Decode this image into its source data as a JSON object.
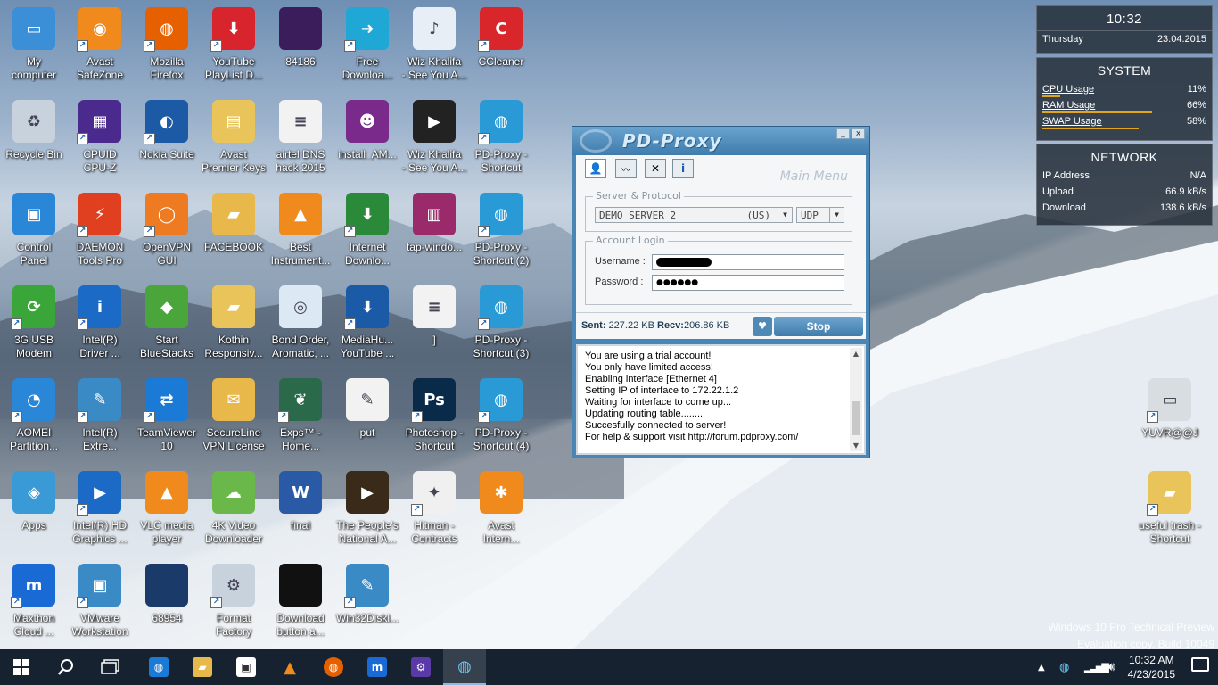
{
  "desktop": {
    "icons": [
      {
        "label": "My\ncomputer",
        "icon": "monitor-icon",
        "color": "#3a8fd6",
        "glyph": "▭",
        "shortcut": false
      },
      {
        "label": "Avast\nSafeZone",
        "icon": "avast-safezone-icon",
        "color": "#f08a1c",
        "glyph": "◉",
        "shortcut": true
      },
      {
        "label": "Mozilla\nFirefox",
        "icon": "firefox-icon",
        "color": "#e66000",
        "glyph": "◍",
        "shortcut": true
      },
      {
        "label": "YouTube\nPlayList D...",
        "icon": "youtube-downloader-icon",
        "color": "#d8242c",
        "glyph": "⬇",
        "shortcut": true
      },
      {
        "label": "84186",
        "icon": "image-thumbnail-icon",
        "color": "#3a1d5a",
        "glyph": "",
        "shortcut": false
      },
      {
        "label": "Free\nDownloa...",
        "icon": "free-download-icon",
        "color": "#1fa7d6",
        "glyph": "➜",
        "shortcut": true
      },
      {
        "label": "Wiz Khalifa\n- See You A...",
        "icon": "m4a-file-icon",
        "color": "#e8eef5",
        "glyph": "♪",
        "shortcut": false
      },
      {
        "label": "CCleaner",
        "icon": "ccleaner-icon",
        "color": "#d9262b",
        "glyph": "C",
        "shortcut": true
      },
      {
        "label": "Recycle Bin",
        "icon": "recycle-bin-icon",
        "color": "#c8d2dc",
        "glyph": "♻",
        "shortcut": false
      },
      {
        "label": "CPUID\nCPU-Z",
        "icon": "cpuz-icon",
        "color": "#4a2a8c",
        "glyph": "▦",
        "shortcut": true
      },
      {
        "label": "Nokia Suite",
        "icon": "nokia-suite-icon",
        "color": "#1c5aa6",
        "glyph": "◐",
        "shortcut": true
      },
      {
        "label": "Avast\nPremier Keys",
        "icon": "folder-docs-icon",
        "color": "#e8c45a",
        "glyph": "▤",
        "shortcut": false
      },
      {
        "label": "airtel DNS\nhack 2015",
        "icon": "text-file-icon",
        "color": "#f2f2f2",
        "glyph": "≡",
        "shortcut": false
      },
      {
        "label": "install_AM...",
        "icon": "installer-icon",
        "color": "#7a2a8a",
        "glyph": "☻",
        "shortcut": false
      },
      {
        "label": "Wiz Khalifa\n- See You A...",
        "icon": "video-file-icon",
        "color": "#222",
        "glyph": "▶",
        "shortcut": false
      },
      {
        "label": "PD-Proxy -\nShortcut",
        "icon": "pd-proxy-icon",
        "color": "#2a9ad6",
        "glyph": "◍",
        "shortcut": true
      },
      {
        "label": "Control\nPanel",
        "icon": "control-panel-icon",
        "color": "#2a86d6",
        "glyph": "▣",
        "shortcut": false
      },
      {
        "label": "DAEMON\nTools Pro",
        "icon": "daemon-tools-icon",
        "color": "#e04020",
        "glyph": "⚡",
        "shortcut": true
      },
      {
        "label": "OpenVPN\nGUI",
        "icon": "openvpn-icon",
        "color": "#ee7a22",
        "glyph": "◯",
        "shortcut": true
      },
      {
        "label": "FACEBOOK",
        "icon": "folder-icon",
        "color": "#e8b84a",
        "glyph": "▰",
        "shortcut": false
      },
      {
        "label": "Best\nInstrument...",
        "icon": "vlc-file-icon",
        "color": "#f08a1c",
        "glyph": "▲",
        "shortcut": false
      },
      {
        "label": "Internet\nDownlo...",
        "icon": "idm-icon",
        "color": "#2a8a3a",
        "glyph": "⬇",
        "shortcut": true
      },
      {
        "label": "tap-windo...",
        "icon": "winrar-icon",
        "color": "#9a2a6a",
        "glyph": "▥",
        "shortcut": false
      },
      {
        "label": "PD-Proxy -\nShortcut (2)",
        "icon": "pd-proxy-icon",
        "color": "#2a9ad6",
        "glyph": "◍",
        "shortcut": true
      },
      {
        "label": "3G USB\nModem",
        "icon": "usb-modem-icon",
        "color": "#3aa63a",
        "glyph": "⟳",
        "shortcut": true
      },
      {
        "label": "Intel(R)\nDriver ...",
        "icon": "intel-driver-icon",
        "color": "#1a6ac6",
        "glyph": "i",
        "shortcut": true
      },
      {
        "label": "Start\nBlueStacks",
        "icon": "bluestacks-icon",
        "color": "#4aa63a",
        "glyph": "◆",
        "shortcut": false
      },
      {
        "label": "Kothin\nResponsiv...",
        "icon": "folder-icon",
        "color": "#e8c45a",
        "glyph": "▰",
        "shortcut": false
      },
      {
        "label": "Bond Order,\nAromatic, ...",
        "icon": "html-file-icon",
        "color": "#dce8f4",
        "glyph": "◎",
        "shortcut": false
      },
      {
        "label": "MediaHu...\nYouTube ...",
        "icon": "mediahuman-icon",
        "color": "#1a5aa6",
        "glyph": "⬇",
        "shortcut": true
      },
      {
        "label": "]",
        "icon": "text-file-icon",
        "color": "#f2f2f2",
        "glyph": "≡",
        "shortcut": false
      },
      {
        "label": "PD-Proxy -\nShortcut (3)",
        "icon": "pd-proxy-icon",
        "color": "#2a9ad6",
        "glyph": "◍",
        "shortcut": true
      },
      {
        "label": "AOMEI\nPartition...",
        "icon": "aomei-icon",
        "color": "#2a86d6",
        "glyph": "◔",
        "shortcut": true
      },
      {
        "label": "Intel(R)\nExtre...",
        "icon": "intel-extreme-icon",
        "color": "#3a8ac6",
        "glyph": "✎",
        "shortcut": true
      },
      {
        "label": "TeamViewer\n10",
        "icon": "teamviewer-icon",
        "color": "#1a7ad6",
        "glyph": "⇄",
        "shortcut": true
      },
      {
        "label": "SecureLine\nVPN License",
        "icon": "secureline-icon",
        "color": "#e8b84a",
        "glyph": "✉",
        "shortcut": false
      },
      {
        "label": "Exps™ -\nHome...",
        "icon": "exps-icon",
        "color": "#2a6a4a",
        "glyph": "❦",
        "shortcut": true
      },
      {
        "label": "put",
        "icon": "put-file-icon",
        "color": "#f2f2f2",
        "glyph": "✎",
        "shortcut": false
      },
      {
        "label": "Photoshop -\nShortcut",
        "icon": "photoshop-icon",
        "color": "#0a2a4a",
        "glyph": "Ps",
        "shortcut": true
      },
      {
        "label": "PD-Proxy -\nShortcut (4)",
        "icon": "pd-proxy-icon",
        "color": "#2a9ad6",
        "glyph": "◍",
        "shortcut": true
      },
      {
        "label": "Apps",
        "icon": "apps-folder-icon",
        "color": "#3a9ad6",
        "glyph": "◈",
        "shortcut": false
      },
      {
        "label": "Intel(R) HD\nGraphics ...",
        "icon": "intel-hd-icon",
        "color": "#1a6ac6",
        "glyph": "▶",
        "shortcut": true
      },
      {
        "label": "VLC media\nplayer",
        "icon": "vlc-icon",
        "color": "#f08a1c",
        "glyph": "▲",
        "shortcut": false
      },
      {
        "label": "4K Video\nDownloader",
        "icon": "4k-video-icon",
        "color": "#6ab84a",
        "glyph": "☁",
        "shortcut": false
      },
      {
        "label": "final",
        "icon": "word-doc-icon",
        "color": "#2a5aa6",
        "glyph": "W",
        "shortcut": false
      },
      {
        "label": "The People's\nNational A...",
        "icon": "video-file-icon",
        "color": "#3a2a1a",
        "glyph": "▶",
        "shortcut": false
      },
      {
        "label": "Hitman -\nContracts",
        "icon": "hitman-icon",
        "color": "#f0f0f0",
        "glyph": "✦",
        "shortcut": true
      },
      {
        "label": "Avast\nIntern...",
        "icon": "avast-icon",
        "color": "#f08a1c",
        "glyph": "✱",
        "shortcut": false
      },
      {
        "label": "Maxthon\nCloud ...",
        "icon": "maxthon-icon",
        "color": "#1a6ad6",
        "glyph": "m",
        "shortcut": true
      },
      {
        "label": "VMware\nWorkstation",
        "icon": "vmware-icon",
        "color": "#3a8ac6",
        "glyph": "▣",
        "shortcut": true
      },
      {
        "label": "68954",
        "icon": "image-thumbnail-icon",
        "color": "#1a3a6a",
        "glyph": "",
        "shortcut": false
      },
      {
        "label": "Format\nFactory",
        "icon": "format-factory-icon",
        "color": "#c8d2dc",
        "glyph": "⚙",
        "shortcut": true
      },
      {
        "label": "Download\nbutton a...",
        "icon": "image-thumbnail-icon",
        "color": "#111",
        "glyph": "",
        "shortcut": false
      },
      {
        "label": "Win32Diskl...",
        "icon": "win32diskimager-icon",
        "color": "#3a8ac6",
        "glyph": "✎",
        "shortcut": true
      },
      {
        "label": "YUVR@@J",
        "icon": "drive-icon",
        "color": "#d8dde2",
        "glyph": "▭",
        "shortcut": true
      },
      {
        "label": "useful trash -\nShortcut",
        "icon": "folder-icon",
        "color": "#e8c45a",
        "glyph": "▰",
        "shortcut": true
      }
    ]
  },
  "widgets": {
    "time": "10:32",
    "day": "Thursday",
    "date": "23.04.2015",
    "system": {
      "title": "SYSTEM",
      "rows": [
        {
          "label": "CPU Usage",
          "value": "11%",
          "fraction": 0.11
        },
        {
          "label": "RAM Usage",
          "value": "66%",
          "fraction": 0.66
        },
        {
          "label": "SWAP Usage",
          "value": "58%",
          "fraction": 0.58
        }
      ]
    },
    "network": {
      "title": "NETWORK",
      "rows": [
        {
          "label": "IP Address",
          "value": "N/A"
        },
        {
          "label": "Upload",
          "value": "66.9 kB/s"
        },
        {
          "label": "Download",
          "value": "138.6 kB/s"
        }
      ]
    }
  },
  "pdproxy": {
    "brand": "PD-Proxy",
    "minimize": "_",
    "close": "x",
    "menu_title": "Main Menu",
    "server_legend": "Server & Protocol",
    "server": "DEMO SERVER 2",
    "server_region": "(US)",
    "protocol": "UDP",
    "account_legend": "Account Login",
    "username_label": "Username :",
    "password_label": "Password :",
    "password_value": "●●●●●●",
    "sent_label": "Sent:",
    "sent_value": "227.22 KB",
    "recv_label": "Recv:",
    "recv_value": "206.86 KB",
    "stop_label": "Stop",
    "log": [
      "You are using a trial account!",
      "You only have limited access!",
      "Enabling interface [Ethernet 4]",
      "Setting IP of interface to 172.22.1.2",
      "Waiting for interface to come up...",
      "Updating routing table........",
      "Succesfully connected to server!",
      "For help & support visit http://forum.pdproxy.com/"
    ]
  },
  "watermark": {
    "line1": "Windows 10 Pro Technical Preview",
    "line2": "Evaluation copy. Build 10049"
  },
  "taskbar": {
    "clock_time": "10:32 AM",
    "clock_date": "4/23/2015"
  }
}
